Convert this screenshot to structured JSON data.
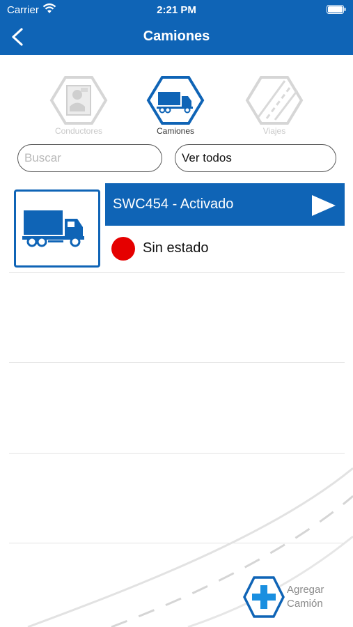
{
  "status_bar": {
    "carrier": "Carrier",
    "time": "2:21 PM"
  },
  "nav": {
    "title": "Camiones"
  },
  "tabs": [
    {
      "label": "Conductores",
      "state": "disabled"
    },
    {
      "label": "Camiones",
      "state": "active"
    },
    {
      "label": "Viajes",
      "state": "disabled"
    }
  ],
  "search": {
    "placeholder": "Buscar",
    "value": ""
  },
  "filter": {
    "value": "Ver todos"
  },
  "trucks": [
    {
      "title": "SWC454 - Activado",
      "status": "Sin estado",
      "status_color": "#e50000"
    }
  ],
  "add_button": {
    "line1": "Agregar",
    "line2": "Camión"
  },
  "colors": {
    "primary": "#0f64b6",
    "status_red": "#e50000"
  }
}
